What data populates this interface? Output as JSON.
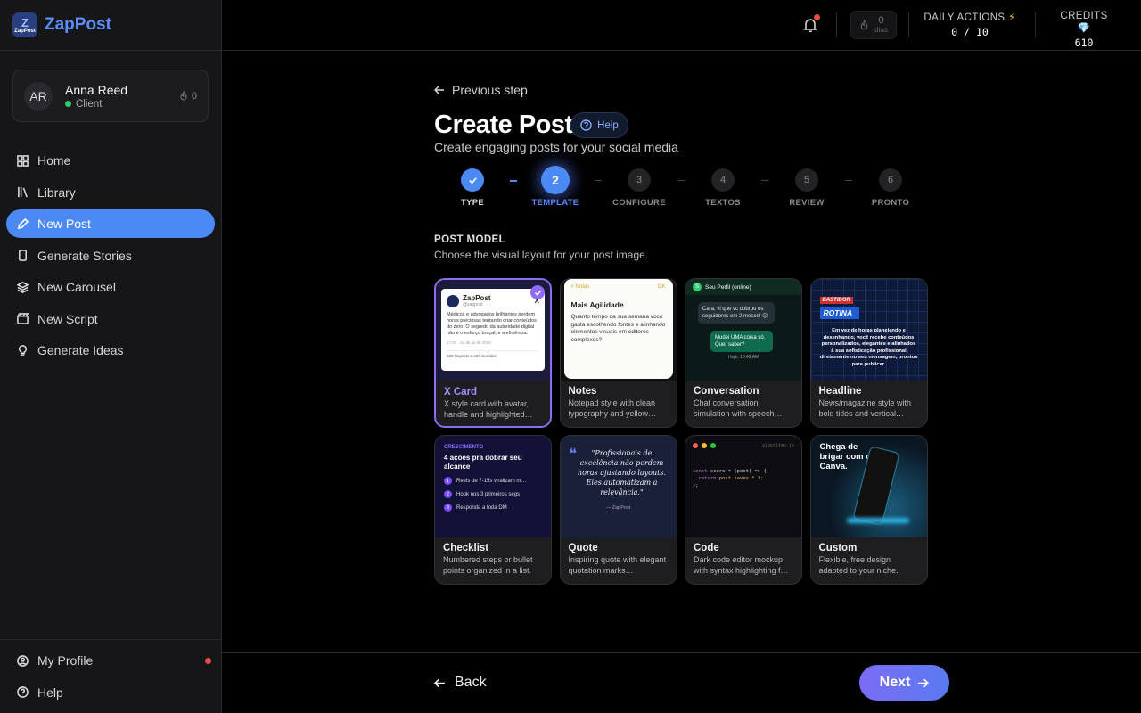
{
  "app": {
    "name": "ZapPost",
    "logo_small": "ZapPost",
    "logo_mark": "Z"
  },
  "user": {
    "initials": "AR",
    "name": "Anna Reed",
    "role": "Client",
    "streak": "0"
  },
  "nav": [
    {
      "label": "Home",
      "icon": "grid-icon"
    },
    {
      "label": "Library",
      "icon": "library-icon"
    },
    {
      "label": "New Post",
      "icon": "pen-icon",
      "active": true
    },
    {
      "label": "Generate Stories",
      "icon": "phone-icon"
    },
    {
      "label": "New Carousel",
      "icon": "layers-icon"
    },
    {
      "label": "New Script",
      "icon": "clapper-icon"
    },
    {
      "label": "Generate Ideas",
      "icon": "bulb-icon"
    }
  ],
  "nav_bottom": [
    {
      "label": "My Profile",
      "icon": "user-circle-icon"
    },
    {
      "label": "Help",
      "icon": "help-circle-icon"
    }
  ],
  "topbar": {
    "streak_value": "0",
    "streak_label": "dias",
    "daily_label": "DAILY ACTIONS",
    "daily_value": "0 / 10",
    "credits_label": "CREDITS",
    "credits_value": "610"
  },
  "page": {
    "previous": "Previous step",
    "title": "Create Post",
    "help": "Help",
    "subtitle": "Create engaging posts for your social media",
    "section_title": "POST MODEL",
    "section_sub": "Choose the visual layout for your post image."
  },
  "steps": [
    {
      "num": "1",
      "label": "TYPE",
      "state": "done"
    },
    {
      "num": "2",
      "label": "TEMPLATE",
      "state": "current"
    },
    {
      "num": "3",
      "label": "CONFIGURE",
      "state": "pending"
    },
    {
      "num": "4",
      "label": "TEXTOS",
      "state": "pending"
    },
    {
      "num": "5",
      "label": "REVIEW",
      "state": "pending"
    },
    {
      "num": "6",
      "label": "PRONTO",
      "state": "pending"
    }
  ],
  "templates": [
    {
      "name": "X Card",
      "desc": "X style card with avatar, handle and highlighted…",
      "selected": true
    },
    {
      "name": "Notes",
      "desc": "Notepad style with clean typography and yellow…"
    },
    {
      "name": "Conversation",
      "desc": "Chat conversation simulation with speech…"
    },
    {
      "name": "Headline",
      "desc": "News/magazine style with bold titles and vertical…"
    },
    {
      "name": "Checklist",
      "desc": "Numbered steps or bullet points organized in a list."
    },
    {
      "name": "Quote",
      "desc": "Inspiring quote with elegant quotation marks…"
    },
    {
      "name": "Code",
      "desc": "Dark code editor mockup with syntax highlighting f…"
    },
    {
      "name": "Custom",
      "desc": "Flexible, free design adapted to your niche."
    }
  ],
  "previews": {
    "xcard": {
      "name": "ZapPost",
      "handle": "@zappost",
      "text": "Médicos e advogados brilhantes perdem horas preciosas tentando criar conteúdos do zero. O segredo da autoridade digital não é o esforço braçal, e a eficiência.",
      "meta": "17:04 · 24 de jul de 2026",
      "stats": "830 Reposts   3.400 Curtidas"
    },
    "notes": {
      "back": "< Notas",
      "ok": "OK",
      "title": "Mais Agilidade",
      "text": "Quanto tempo da sua semana você gasta escolhendo fontes e alinhando elementos visuais em editores complexos?"
    },
    "conversation": {
      "contact": "Seu Perfil (online)",
      "msg1": "Cara, vi que vc dobrou os seguidores em 2 meses! 😮",
      "msg2": "Mudei UMA coisa só. Quer saber?",
      "time": "Hoje, 10:42 AM"
    },
    "headline": {
      "kicker": "BASTIDOR",
      "tag": "ROTINA",
      "text": "Em vez de horas planejando e desenhando, você recebe conteúdos personalizados, elegantes e alinhados à sua sofisticação profissional diretamente no seu mensagem, prontos para publicar."
    },
    "checklist": {
      "kicker": "CRESCIMENTO",
      "title": "4 ações pra dobrar seu alcance",
      "items": [
        "Reels de 7-15s viralizam m…",
        "Hook nos 3 primeiros segs",
        "Responda a toda DM"
      ]
    },
    "quote": {
      "text": "\"Profissionais de excelência não perdem horas ajustando layouts. Eles automatizam a relevância.\"",
      "by": "— ZapPost"
    },
    "code": {
      "file": "algoritmo.js",
      "line1a": "const",
      "line1b": " score = (post) => {",
      "line2a": "  return",
      "line2b": " post.saves * 3;",
      "line3": "};"
    },
    "custom": {
      "text": "Chega de brigar com o Canva."
    }
  },
  "footer": {
    "back": "Back",
    "next": "Next"
  },
  "colors": {
    "accent": "#4b8af5",
    "selected": "#8e6cf5",
    "sidebar_bg": "#161618"
  }
}
